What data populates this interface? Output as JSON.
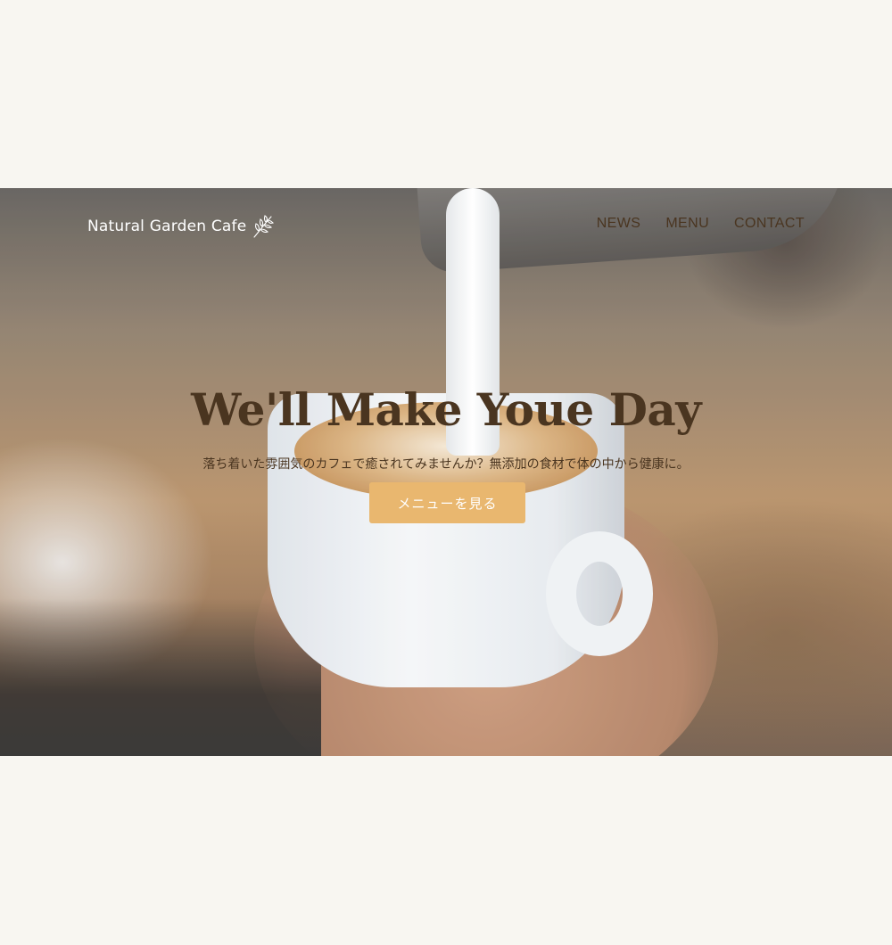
{
  "header": {
    "logo_text": "Natural Garden Cafe",
    "logo_icon": "leaf-icon",
    "nav": [
      {
        "label": "NEWS"
      },
      {
        "label": "MENU"
      },
      {
        "label": "CONTACT"
      }
    ]
  },
  "hero": {
    "title": "We'll Make Youe Day",
    "subtitle": "落ち着いた雰囲気のカフェで癒されてみませんか？無添加の食材で体の中から健康に。",
    "cta_label": "メニューを見る"
  },
  "colors": {
    "page_background": "#f8f6f1",
    "text_brown": "#4a3520",
    "accent": "#e9b76f"
  }
}
